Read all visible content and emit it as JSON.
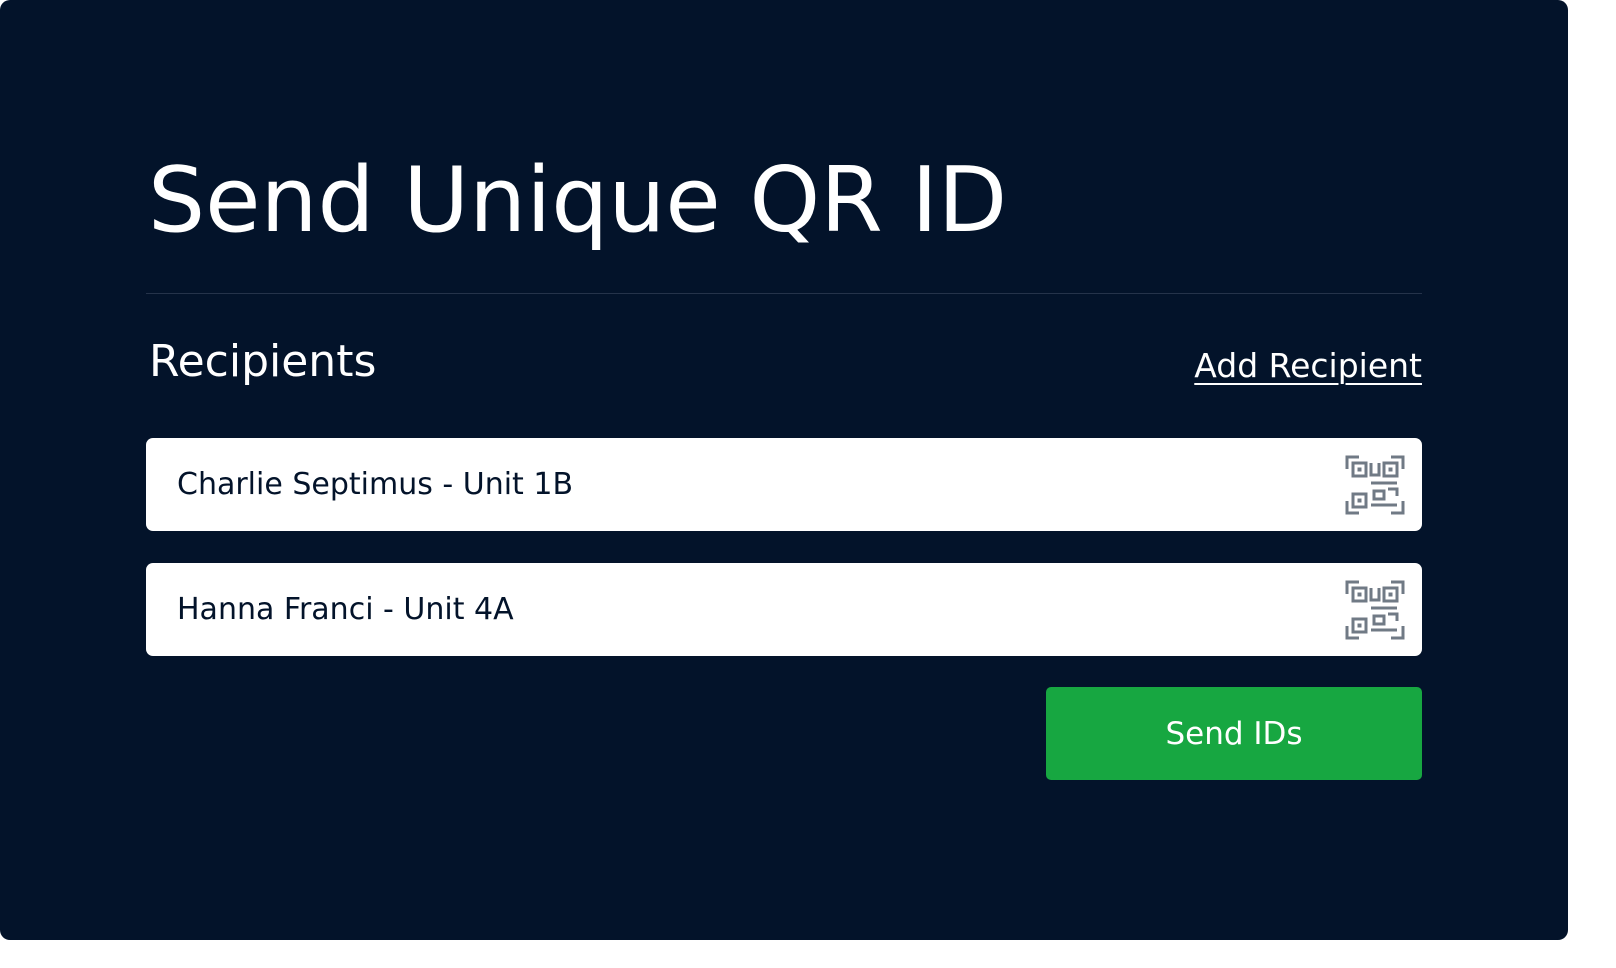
{
  "page": {
    "title": "Send Unique QR ID"
  },
  "recipients": {
    "heading": "Recipients",
    "add_label": "Add Recipient",
    "items": [
      {
        "label": "Charlie Septimus - Unit 1B",
        "icon": "qr-code-icon"
      },
      {
        "label": "Hanna Franci - Unit 4A",
        "icon": "qr-code-icon"
      }
    ]
  },
  "actions": {
    "send_label": "Send IDs"
  },
  "colors": {
    "background": "#03132a",
    "accent": "#17a741",
    "divider": "#25334a",
    "icon": "#707a85",
    "row_background": "#ffffff"
  }
}
